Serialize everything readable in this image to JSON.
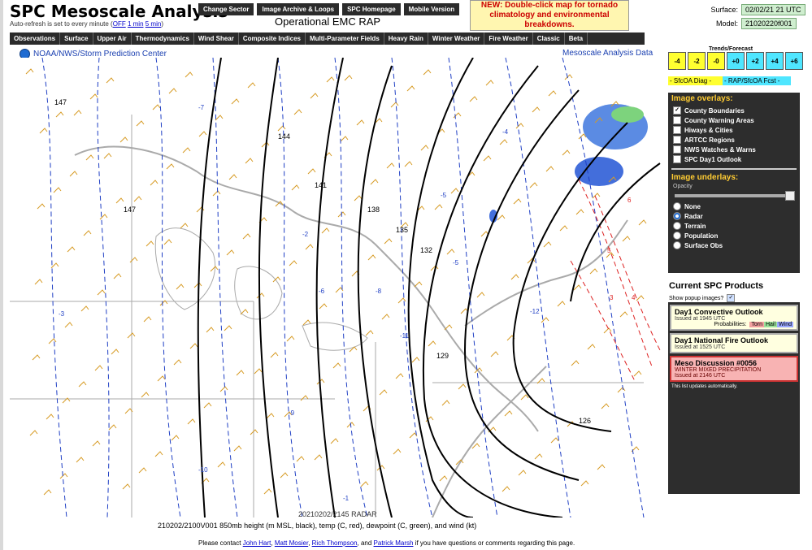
{
  "header": {
    "title": "SPC Mesoscale Analysis",
    "refresh_prefix": "Auto-refresh is set to every minute (",
    "refresh_off": "OFF",
    "refresh_1min": "1 min",
    "refresh_5min": "5 min",
    "refresh_suffix": ")",
    "model_title": "Operational EMC RAP",
    "notice": "NEW: Double-click map for tornado climatology and environmental breakdowns.",
    "surface_label": "Surface:",
    "surface_value": "02/02/21 21 UTC",
    "model_label": "Model:",
    "model_value": "21020220f001"
  },
  "top_buttons": [
    "Change Sector",
    "Image Archive & Loops",
    "SPC Homepage",
    "Mobile Version"
  ],
  "nav": [
    "Observations",
    "Surface",
    "Upper Air",
    "Thermodynamics",
    "Wind Shear",
    "Composite Indices",
    "Multi-Parameter Fields",
    "Heavy Rain",
    "Winter Weather",
    "Fire Weather",
    "Classic",
    "Beta"
  ],
  "map": {
    "source": "NOAA/NWS/Storm Prediction Center",
    "product": "Mesoscale Analysis Data",
    "caption": "210202/2100V001 850mb height (m MSL, black), temp (C, red), dewpoint (C, green), and wind (kt)",
    "radar_stamp": "20210202/2145 RADAR",
    "height_labels": [
      "147",
      "144",
      "141",
      "138",
      "135",
      "132",
      "129",
      "126",
      "147"
    ],
    "dewpoint_labels": [
      "-7",
      "-6",
      "-5",
      "-4",
      "-3",
      "-2",
      "-8",
      "-9",
      "-10",
      "-1",
      "-11",
      "-12",
      "-5"
    ],
    "temp_labels": [
      "3",
      "4",
      "5",
      "6"
    ]
  },
  "trends": {
    "title": "Trends/Forecast",
    "buttons": [
      "-4",
      "-2",
      "-0",
      "+0",
      "+2",
      "+4",
      "+6"
    ],
    "label_diag": "- SfcOA Diag -",
    "label_fcst": "- RAP/SfcOA Fcst -"
  },
  "overlays": {
    "title": "Image overlays:",
    "items": [
      {
        "label": "County Boundaries",
        "checked": true
      },
      {
        "label": "County Warning Areas",
        "checked": false
      },
      {
        "label": "Hiways & Cities",
        "checked": false
      },
      {
        "label": "ARTCC Regions",
        "checked": false
      },
      {
        "label": "NWS Watches & Warns",
        "checked": false
      },
      {
        "label": "SPC Day1 Outlook",
        "checked": false
      }
    ]
  },
  "underlays": {
    "title": "Image underlays:",
    "opacity_label": "Opacity",
    "items": [
      {
        "label": "None",
        "selected": false
      },
      {
        "label": "Radar",
        "selected": true
      },
      {
        "label": "Terrain",
        "selected": false
      },
      {
        "label": "Population",
        "selected": false
      },
      {
        "label": "Surface Obs",
        "selected": false
      }
    ]
  },
  "products": {
    "title": "Current SPC Products",
    "popup_label": "Show popup images?",
    "convective": {
      "title": "Day1 Convective Outlook",
      "issued": "Issued at 1945 UTC",
      "prob_label": "Probabilities:",
      "torn": "Torn",
      "hail": "Hail",
      "wind": "Wind"
    },
    "fire": {
      "title": "Day1 National Fire Outlook",
      "issued": "Issued at 1525 UTC"
    },
    "meso": {
      "title": "Meso Discussion #0056",
      "subtitle": "WINTER MIXED PRECIPITATION",
      "issued": "Issued at 2146 UTC"
    },
    "note": "This list updates automatically."
  },
  "footer": {
    "prefix": "Please contact ",
    "names": [
      "John Hart",
      "Matt Mosier",
      "Rich Thompson",
      "Patrick Marsh"
    ],
    "suffix": " if you have questions or comments regarding this page."
  },
  "colors": {
    "height": "#000000",
    "dewpoint": "#1f3fc4",
    "temp": "#d22",
    "wind": "#d69a22",
    "panel": "#2d2d2d"
  }
}
